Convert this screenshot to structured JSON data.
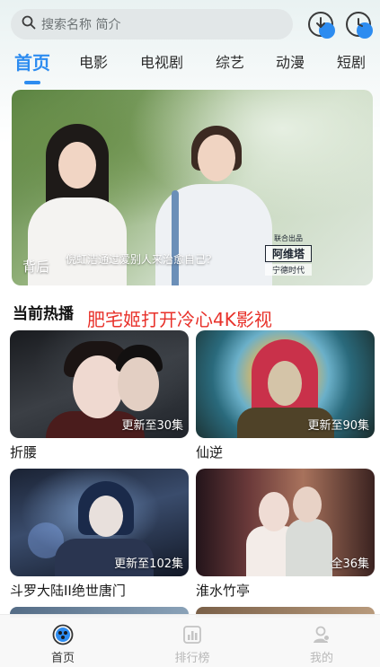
{
  "search": {
    "placeholder": "搜索名称 简介"
  },
  "tabs": [
    {
      "label": "首页",
      "active": true
    },
    {
      "label": "电影",
      "active": false
    },
    {
      "label": "电视剧",
      "active": false
    },
    {
      "label": "综艺",
      "active": false
    },
    {
      "label": "动漫",
      "active": false
    },
    {
      "label": "短剧",
      "active": false
    }
  ],
  "banner": {
    "title": "背后",
    "quote": "倪虹洁通过爱别人来治愈自己?",
    "logo_top": "联合出品",
    "logo_brand": "阿维塔",
    "logo_sub": "宁德时代"
  },
  "section": {
    "title": "当前热播",
    "watermark": "肥宅姬打开冷心4K影视"
  },
  "cards": [
    {
      "name": "折腰",
      "badge": "更新至30集"
    },
    {
      "name": "仙逆",
      "badge": "更新至90集"
    },
    {
      "name": "斗罗大陆II绝世唐门",
      "badge": "更新至102集"
    },
    {
      "name": "淮水竹亭",
      "badge": "全36集"
    }
  ],
  "bottom_nav": [
    {
      "label": "首页",
      "icon": "home-icon",
      "active": true
    },
    {
      "label": "排行榜",
      "icon": "ranking-icon",
      "active": false
    },
    {
      "label": "我的",
      "icon": "profile-icon",
      "active": false
    }
  ],
  "colors": {
    "accent": "#2d8cf0",
    "watermark": "#e8312a"
  }
}
